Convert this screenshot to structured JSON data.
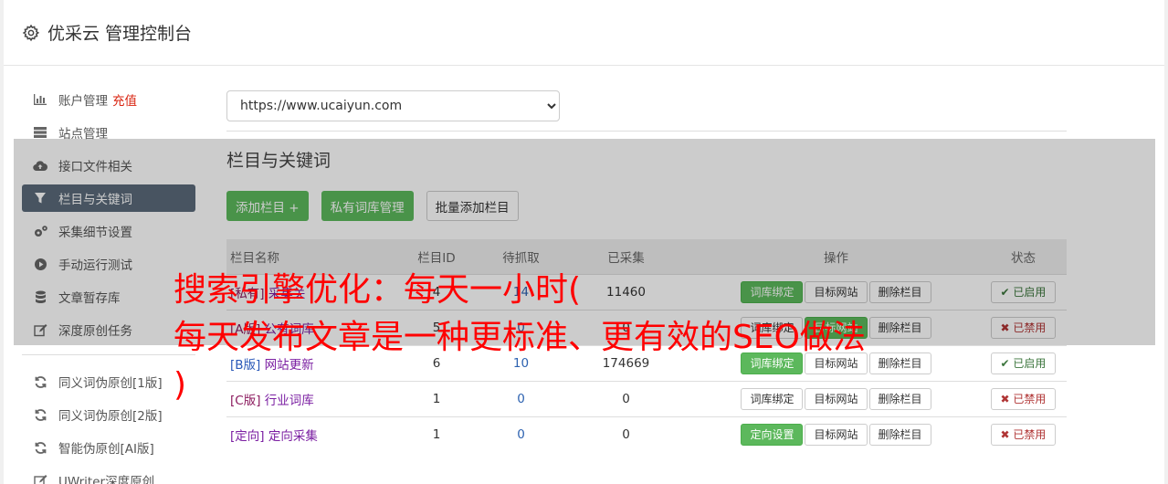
{
  "header": {
    "title": "优采云 管理控制台"
  },
  "sidebar": {
    "items": [
      {
        "label": "账户管理",
        "badge": "充值",
        "icon": "bar-chart-icon"
      },
      {
        "label": "站点管理",
        "icon": "server-icon"
      },
      {
        "label": "接口文件相关",
        "icon": "cloud-upload-icon"
      },
      {
        "label": "栏目与关键词",
        "icon": "filter-icon",
        "active": true
      },
      {
        "label": "采集细节设置",
        "icon": "cogs-icon"
      },
      {
        "label": "手动运行测试",
        "icon": "play-icon"
      },
      {
        "label": "文章暂存库",
        "icon": "database-icon"
      },
      {
        "label": "深度原创任务",
        "icon": "edit-icon"
      }
    ],
    "items2": [
      {
        "label": "同义词伪原创[1版]",
        "icon": "refresh-icon"
      },
      {
        "label": "同义词伪原创[2版]",
        "icon": "refresh-icon"
      },
      {
        "label": "智能伪原创[AI版]",
        "icon": "refresh-icon"
      },
      {
        "label": "UWriter深度原创",
        "icon": "edit-icon"
      }
    ]
  },
  "main": {
    "site_select": "https://www.ucaiyun.com",
    "section_title": "栏目与关键词",
    "buttons": {
      "add": "添加栏目 +",
      "private": "私有词库管理",
      "batch": "批量添加栏目"
    },
    "table": {
      "headers": {
        "name": "栏目名称",
        "id": "栏目ID",
        "pending": "待抓取",
        "collected": "已采集",
        "ops": "操作",
        "status": "状态"
      },
      "rows": [
        {
          "tag": "[私有]",
          "name": "采集关",
          "id": "4",
          "pending": "14",
          "collected": "11460",
          "op1": "词库绑定",
          "op2": "目标网站",
          "op3": "删除栏目",
          "status": "已启用",
          "on": true
        },
        {
          "tag": "[A版]",
          "name": "公有词库",
          "id": "5",
          "pending": "0",
          "collected": "0",
          "op1": "词库绑定",
          "op2": "目标网站",
          "op3": "删除栏目",
          "status": "已禁用",
          "on": false
        },
        {
          "tag": "[B版]",
          "name": "网站更新",
          "id": "6",
          "pending": "10",
          "collected": "174669",
          "op1": "词库绑定",
          "op2": "目标网站",
          "op3": "删除栏目",
          "status": "已启用",
          "on": true
        },
        {
          "tag": "[C版]",
          "name": "行业词库",
          "id": "1",
          "pending": "0",
          "collected": "0",
          "op1": "词库绑定",
          "op2": "目标网站",
          "op3": "删除栏目",
          "status": "已禁用",
          "on": false
        },
        {
          "tag": "[定向]",
          "name": "定向采集",
          "id": "1",
          "pending": "0",
          "collected": "0",
          "op1": "定向设置",
          "op2": "目标网站",
          "op3": "删除栏目",
          "status": "已禁用",
          "on": false
        }
      ]
    }
  },
  "promo": {
    "line1": "搜索引擎优化：每天一小时(",
    "line2": "每天发布文章是一种更标准、更有效的SEO做法",
    "line3": ")"
  },
  "colors": {
    "accent_green": "#5cb85c",
    "active_nav": "#5a6a7a",
    "promo_red": "#ff0000",
    "badge_red": "#d9230f"
  }
}
